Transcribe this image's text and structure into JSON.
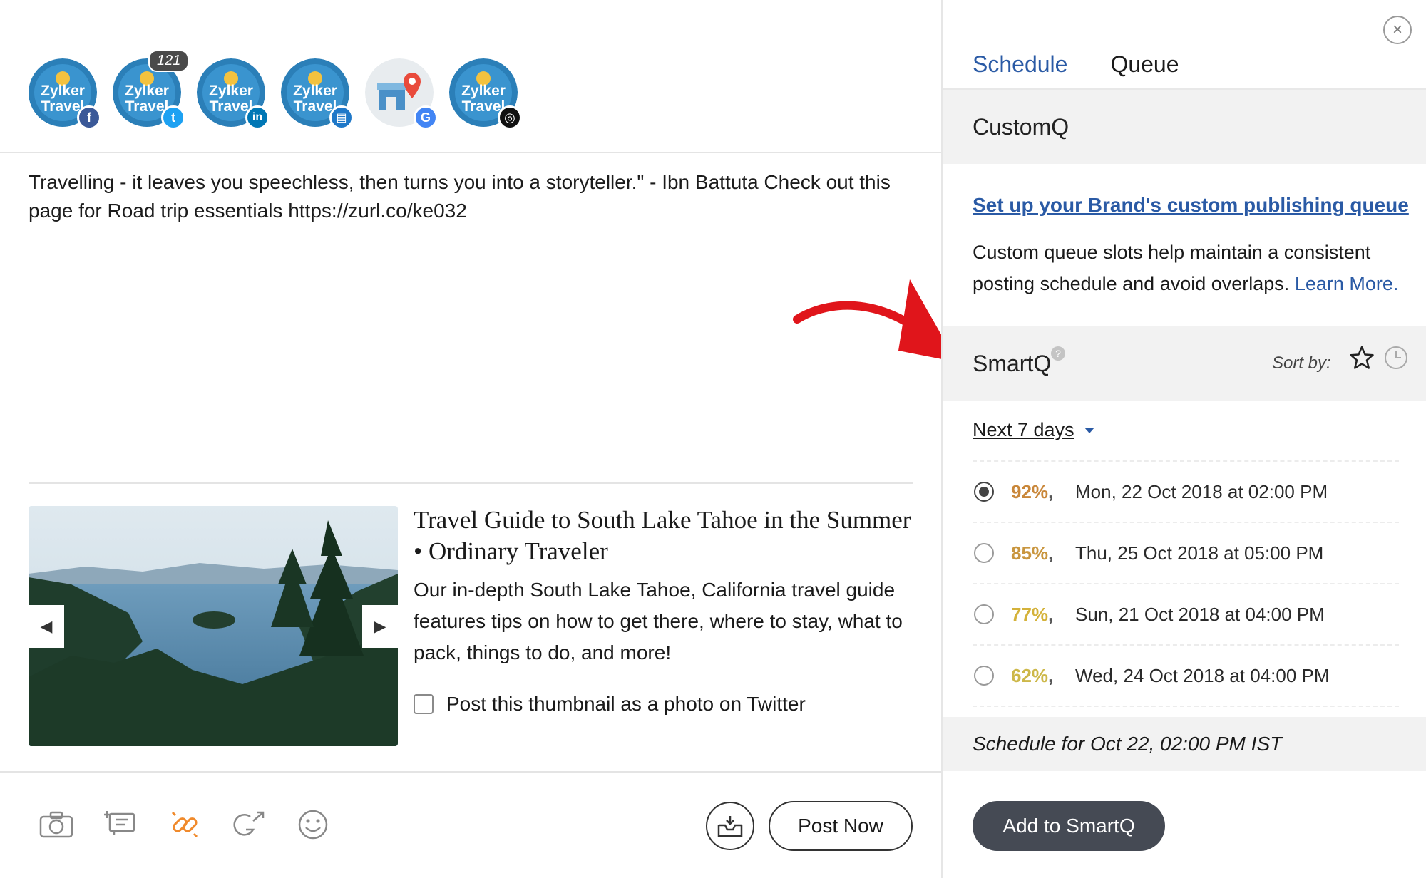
{
  "accounts": {
    "items": [
      {
        "logo_line1": "Zylker",
        "logo_line2": "Travel",
        "network": "facebook-icon",
        "badge_glyph": "f",
        "badge_color": "#3b5998"
      },
      {
        "logo_line1": "Zylker",
        "logo_line2": "Travel",
        "network": "twitter-icon",
        "badge_glyph": "t",
        "badge_color": "#1da1f2",
        "count": "121"
      },
      {
        "logo_line1": "Zylker",
        "logo_line2": "Travel",
        "network": "linkedin-icon",
        "badge_glyph": "in",
        "badge_color": "#0077b5"
      },
      {
        "logo_line1": "Zylker",
        "logo_line2": "Travel",
        "network": "linkedin-page-icon",
        "badge_glyph": "▤",
        "badge_color": "#1f78c8"
      },
      {
        "network": "google-icon",
        "badge_glyph": "G",
        "badge_color": "#4285f4"
      },
      {
        "logo_line1": "Zylker",
        "logo_line2": "Travel",
        "network": "instagram-icon",
        "badge_glyph": "◎",
        "badge_color": "#111111"
      }
    ]
  },
  "composer": {
    "text": "Travelling - it leaves you speechless, then turns you into a storyteller.\" - Ibn Battuta Check out this page for Road trip essentials https://zurl.co/ke032"
  },
  "link_preview": {
    "title": "Travel Guide to South Lake Tahoe in the Summer • Ordinary Traveler",
    "description": "Our in-depth South Lake Tahoe, California travel guide features tips on how to get there, where to stay, what to pack, things to do, and more!",
    "prev_glyph": "◀",
    "next_glyph": "▶",
    "thumbnail_checkbox_label": "Post this thumbnail as a photo on Twitter"
  },
  "toolbar": {
    "tools": [
      "camera-icon",
      "add-text-icon",
      "link-icon",
      "google-share-icon",
      "emoji-icon"
    ],
    "post_now_label": "Post Now"
  },
  "panel": {
    "close_glyph": "×",
    "tabs": [
      {
        "label": "Schedule"
      },
      {
        "label": "Queue"
      }
    ],
    "customq": {
      "title": "CustomQ",
      "setup_link": "Set up your Brand's custom publishing queue",
      "description": "Custom queue slots help maintain a consistent posting schedule and avoid overlaps.",
      "learn_more": "Learn More."
    },
    "smartq": {
      "title": "SmartQ",
      "help_glyph": "?",
      "sort_label": "Sort by:",
      "range_label": "Next 7 days",
      "slots": [
        {
          "percent": "92%",
          "separator": ",",
          "time": "Mon, 22 Oct 2018 at 02:00 PM",
          "color": "#c9873a",
          "selected": true
        },
        {
          "percent": "85%",
          "separator": ",",
          "time": "Thu, 25 Oct 2018 at 05:00 PM",
          "color": "#c9963f",
          "selected": false
        },
        {
          "percent": "77%",
          "separator": ",",
          "time": "Sun, 21 Oct 2018 at 04:00 PM",
          "color": "#d4b23a",
          "selected": false
        },
        {
          "percent": "62%",
          "separator": ",",
          "time": "Wed, 24 Oct 2018 at 04:00 PM",
          "color": "#cdb84a",
          "selected": false
        }
      ]
    },
    "schedule_for": "Schedule for Oct 22, 02:00 PM  IST",
    "add_button": "Add to SmartQ"
  },
  "colors": {
    "link_blue": "#2a5aa5",
    "tab_underline": "#f08a2c",
    "annotation_arrow": "#e0151b",
    "button_dark": "#454a54"
  }
}
